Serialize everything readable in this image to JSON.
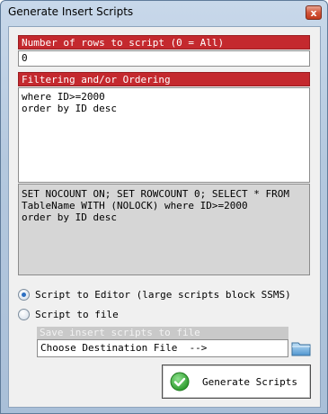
{
  "window": {
    "title": "Generate Insert Scripts",
    "close_glyph": "x"
  },
  "rows": {
    "header": "Number of rows to script (0 = All)",
    "value": "0"
  },
  "filter": {
    "header": "Filtering and/or Ordering",
    "value": "where ID>=2000\norder by ID desc"
  },
  "preview": {
    "text": "SET NOCOUNT ON; SET ROWCOUNT 0; SELECT * FROM\nTableName WITH (NOLOCK) where ID>=2000\norder by ID desc"
  },
  "output": {
    "options": [
      {
        "label": "Script to Editor (large scripts block SSMS)",
        "checked": true
      },
      {
        "label": "Script to file",
        "checked": false
      }
    ],
    "save_header": "Save insert scripts to file",
    "destination": "Choose Destination File  -->"
  },
  "actions": {
    "generate_label": "Generate Scripts"
  },
  "icons": {
    "close": "close-icon",
    "folder": "folder-icon",
    "check": "check-icon"
  },
  "colors": {
    "header_red": "#c4292e",
    "check_green": "#3aa83a"
  }
}
